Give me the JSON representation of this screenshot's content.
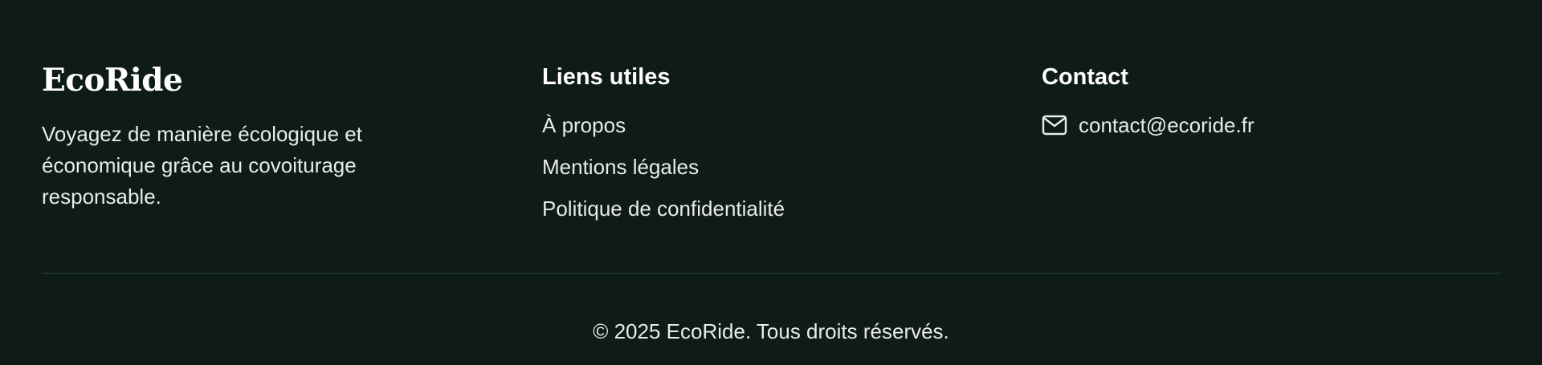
{
  "brand": {
    "name": "EcoRide",
    "description": "Voyagez de manière écologique et économique grâce au covoiturage responsable."
  },
  "links": {
    "heading": "Liens utiles",
    "items": [
      {
        "label": "À propos"
      },
      {
        "label": "Mentions légales"
      },
      {
        "label": "Politique de confidentialité"
      }
    ]
  },
  "contact": {
    "heading": "Contact",
    "icon": "mail-icon",
    "email": "contact@ecoride.fr"
  },
  "copyright": "© 2025 EcoRide. Tous droits réservés.",
  "colors": {
    "background": "#0e1b16",
    "text": "#e9ebe8",
    "heading": "#ffffff",
    "divider": "#23433a"
  }
}
